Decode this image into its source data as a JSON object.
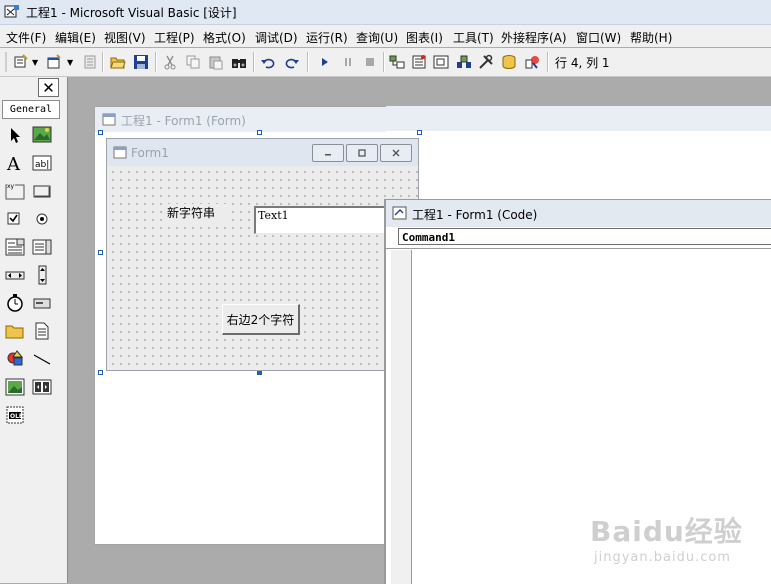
{
  "window": {
    "title": "工程1 - Microsoft Visual Basic [设计]"
  },
  "menu": [
    "文件(F)",
    "编辑(E)",
    "视图(V)",
    "工程(P)",
    "格式(O)",
    "调试(D)",
    "运行(R)",
    "查询(U)",
    "图表(I)",
    "工具(T)",
    "外接程序(A)",
    "窗口(W)",
    "帮助(H)"
  ],
  "toolbar": {
    "icons": [
      "add-project-icon",
      "add-form-icon",
      "menu-editor-icon",
      "open-icon",
      "save-icon",
      "cut-icon",
      "copy-icon",
      "paste-icon",
      "find-icon",
      "undo-icon",
      "redo-icon",
      "start-icon",
      "break-icon",
      "end-icon",
      "project-explorer-icon",
      "properties-icon",
      "form-layout-icon",
      "object-browser-icon",
      "toolbox-icon",
      "data-view-icon",
      "component-manager-icon"
    ],
    "position": "行 4, 列 1"
  },
  "toolbox": {
    "tab": "General",
    "tools": [
      "pointer-icon",
      "picturebox-icon",
      "label-icon",
      "textbox-icon",
      "frame-icon",
      "commandbutton-icon",
      "checkbox-icon",
      "optionbutton-icon",
      "combobox-icon",
      "listbox-icon",
      "hscrollbar-icon",
      "vscrollbar-icon",
      "timer-icon",
      "drivelistbox-icon",
      "dirlistbox-icon",
      "filelistbox-icon",
      "shape-icon",
      "line-icon",
      "image-icon",
      "data-icon",
      "ole-icon"
    ]
  },
  "designer": {
    "title": "工程1 - Form1 (Form)"
  },
  "form1": {
    "title": "Form1",
    "label": "新字符串",
    "textbox": "Text1",
    "button": "右边2个字符"
  },
  "code": {
    "title": "工程1 - Form1 (Code)",
    "object": "Command1"
  },
  "watermark": {
    "brand": "Baidu经验",
    "url": "jingyan.baidu.com"
  },
  "colors": {
    "selection": "#1d5fb5",
    "workspace": "#ababab",
    "form_bg": "#ececec"
  }
}
